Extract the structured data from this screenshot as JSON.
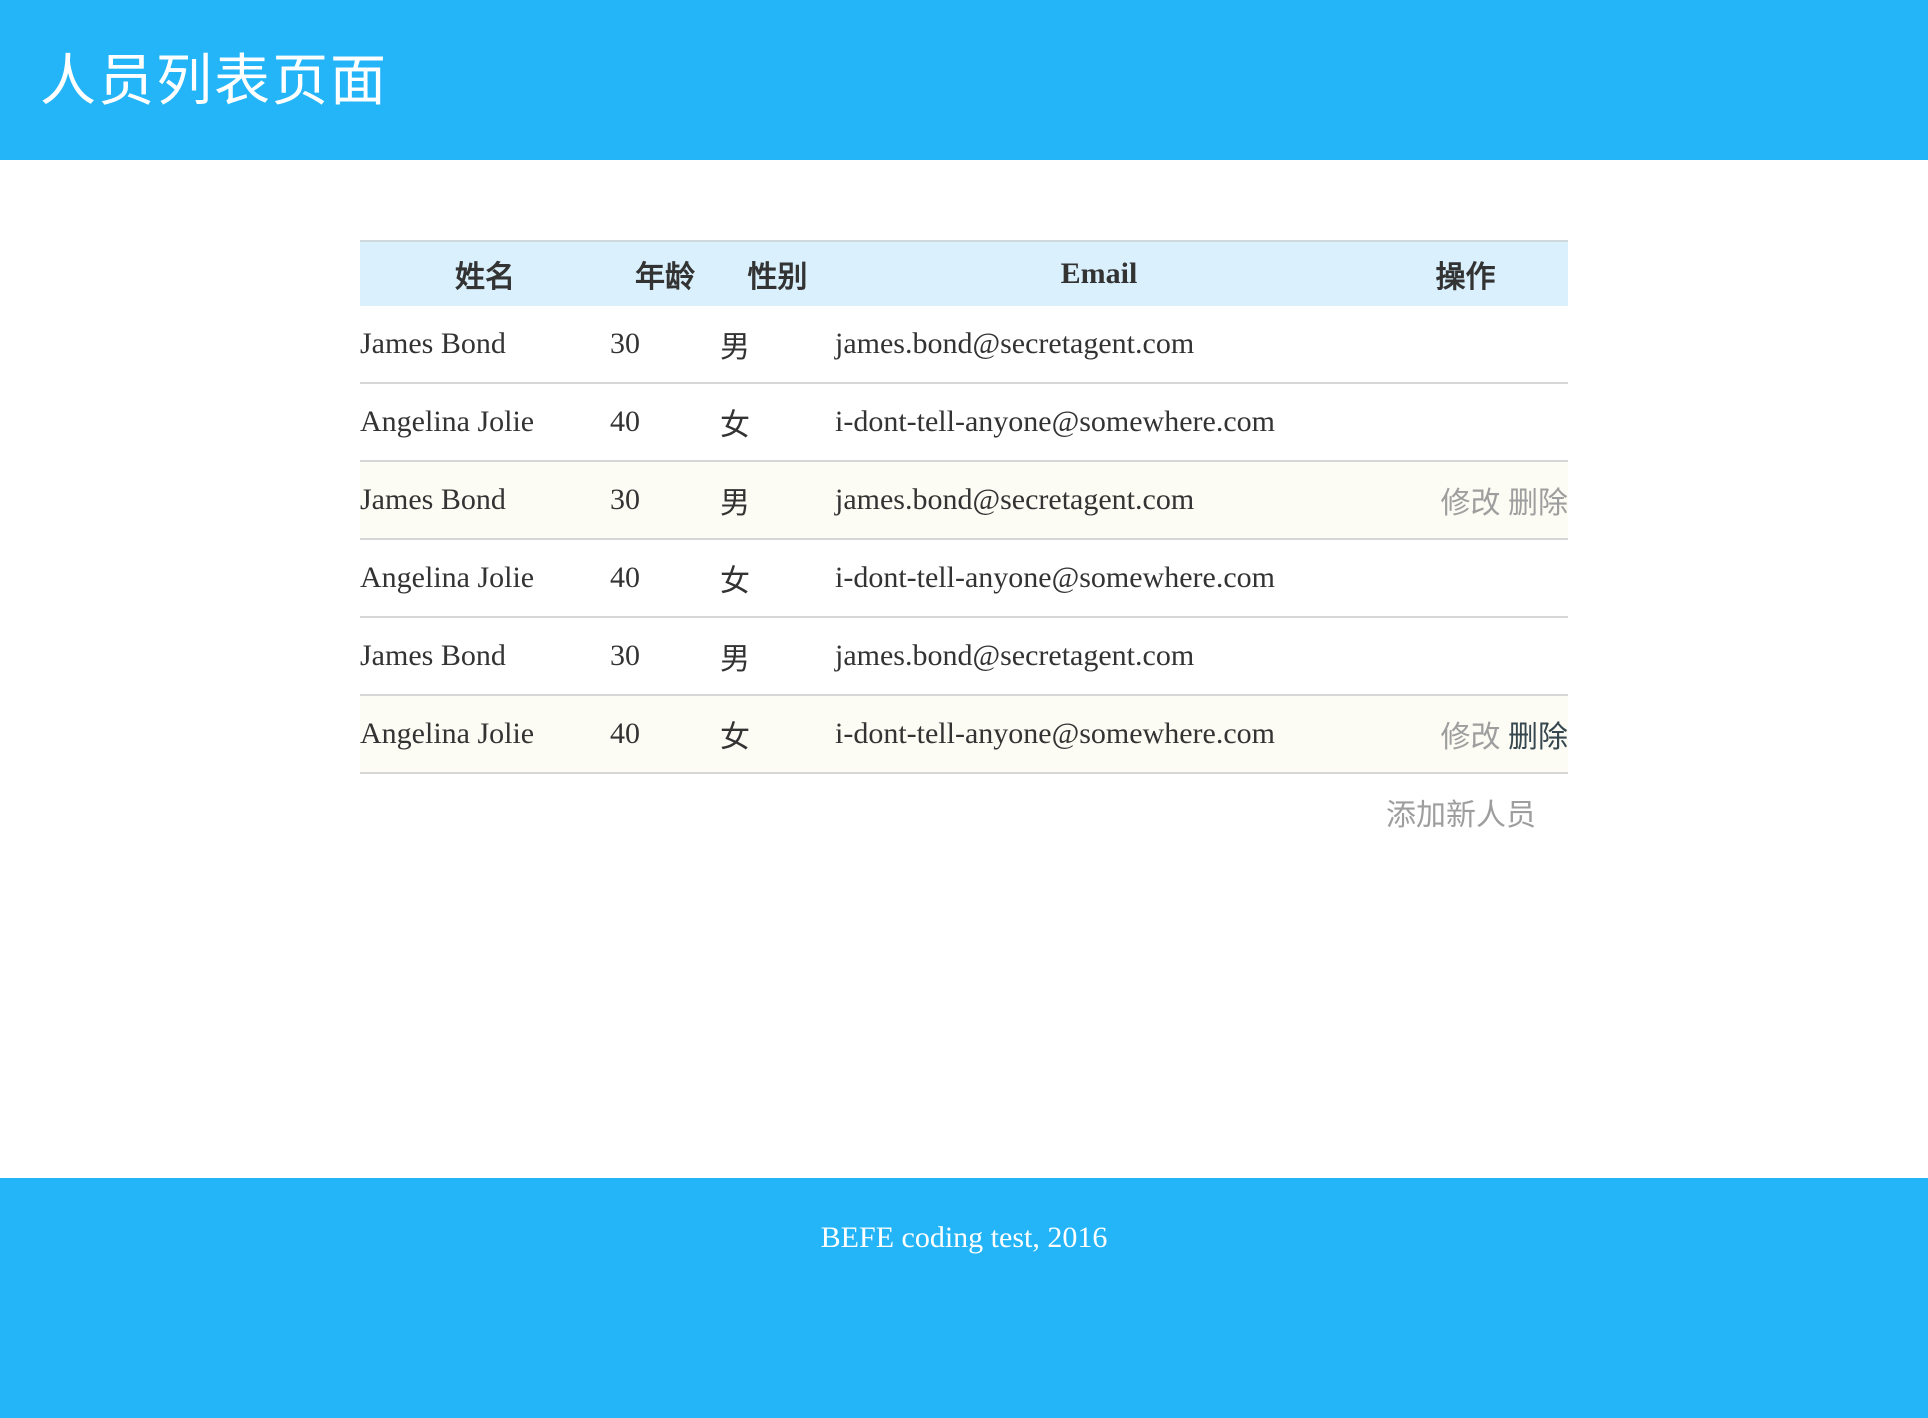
{
  "header": {
    "title": "人员列表页面"
  },
  "table": {
    "columns": [
      "姓名",
      "年龄",
      "性别",
      "Email",
      "操作"
    ],
    "rows": [
      {
        "name": "James Bond",
        "age": "30",
        "gender": "男",
        "email": "james.bond@secretagent.com",
        "edit": "",
        "delete": "",
        "highlight": false
      },
      {
        "name": "Angelina Jolie",
        "age": "40",
        "gender": "女",
        "email": "i-dont-tell-anyone@somewhere.com",
        "edit": "",
        "delete": "",
        "highlight": false
      },
      {
        "name": "James Bond",
        "age": "30",
        "gender": "男",
        "email": "james.bond@secretagent.com",
        "edit": "修改",
        "delete": "删除",
        "highlight": true
      },
      {
        "name": "Angelina Jolie",
        "age": "40",
        "gender": "女",
        "email": "i-dont-tell-anyone@somewhere.com",
        "edit": "",
        "delete": "",
        "highlight": false
      },
      {
        "name": "James Bond",
        "age": "30",
        "gender": "男",
        "email": "james.bond@secretagent.com",
        "edit": "",
        "delete": "",
        "highlight": false
      },
      {
        "name": "Angelina Jolie",
        "age": "40",
        "gender": "女",
        "email": "i-dont-tell-anyone@somewhere.com",
        "edit": "修改",
        "delete": "删除",
        "highlight": true
      }
    ]
  },
  "add_label": "添加新人员",
  "footer": {
    "text": "BEFE coding test, 2016"
  },
  "colors": {
    "brand_blue": "#24b5f8",
    "header_row_bg": "#daf1fd",
    "highlight_row_bg": "#fcfcf4",
    "muted_link": "#9e9e9e",
    "hover_link": "#37474f"
  }
}
